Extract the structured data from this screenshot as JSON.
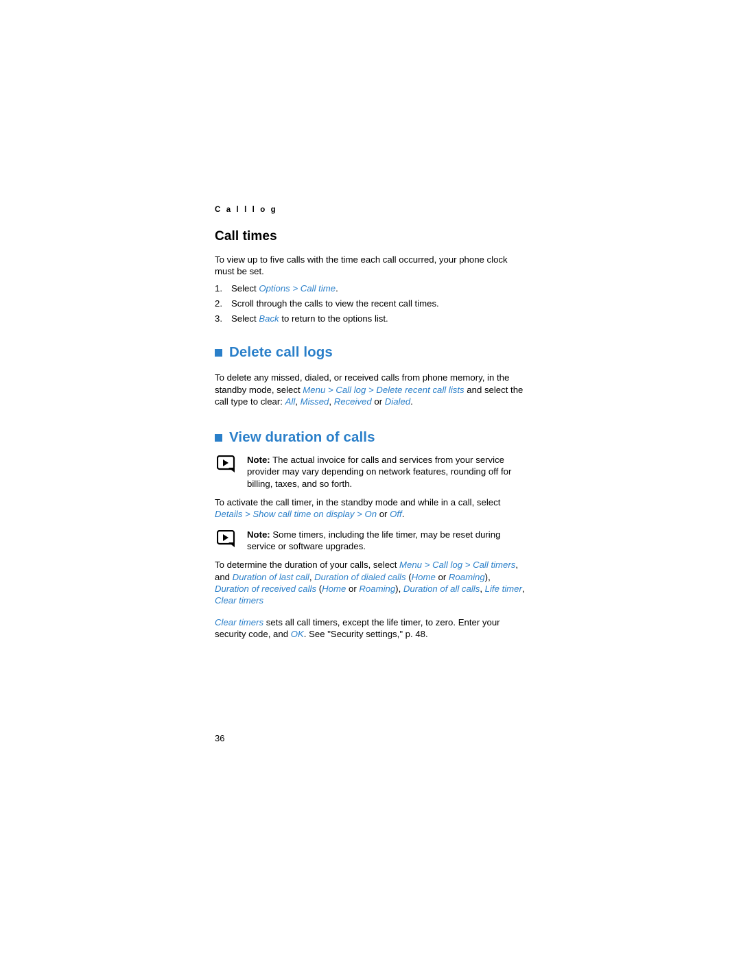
{
  "page": {
    "running_head": "C a l l   l o g",
    "page_number": "36",
    "accent_color": "#2a7fc9"
  },
  "call_times": {
    "heading": "Call times",
    "intro": "To view up to five calls with the time each call occurred, your phone clock must be set.",
    "steps": [
      {
        "num": "1.",
        "pre": "Select ",
        "ui": "Options > Call time",
        "post": "."
      },
      {
        "num": "2.",
        "pre": "Scroll through the calls to view the recent call times.",
        "ui": "",
        "post": ""
      },
      {
        "num": "3.",
        "pre": "Select ",
        "ui": "Back",
        "post": " to return to the options list."
      }
    ]
  },
  "delete_call_logs": {
    "heading": "Delete call logs",
    "para_1a": "To delete any missed, dialed, or received calls from phone memory, in the standby mode, select ",
    "para_1_ui_1": "Menu",
    "para_1b": " > ",
    "para_1_ui_2": "Call log",
    "para_1c": " > ",
    "para_1_ui_3": "Delete recent call lists",
    "para_1d": " and select the call type to clear: ",
    "para_1_ui_4": "All",
    "para_1e": ", ",
    "para_1_ui_5": "Missed",
    "para_1f": ", ",
    "para_1_ui_6": "Received",
    "para_1g": " or ",
    "para_1_ui_7": "Dialed",
    "para_1h": "."
  },
  "view_duration": {
    "heading": "View duration of calls",
    "note_1_label": "Note:",
    "note_1_text": " The actual invoice for calls and services from your service provider may vary depending on network features, rounding off for billing, taxes, and so forth.",
    "para_2a": "To activate the call timer, in the standby mode and while in a call, select ",
    "para_2_ui_1": "Details",
    "para_2b": " > ",
    "para_2_ui_2": "Show call time on display",
    "para_2c": " > ",
    "para_2_ui_3": "On",
    "para_2d": " or ",
    "para_2_ui_4": "Off",
    "para_2e": ".",
    "note_2_label": "Note:",
    "note_2_text": " Some timers, including the life timer, may be reset during service or software upgrades.",
    "para_3a": "To determine the duration of your calls, select ",
    "para_3_ui_1": "Menu",
    "para_3b": " > ",
    "para_3_ui_2": "Call log",
    "para_3c": " > ",
    "para_3_ui_3": "Call timers",
    "para_3d": ", and ",
    "para_3_ui_4": "Duration of last call",
    "para_3e": ", ",
    "para_3_ui_5": "Duration of dialed calls",
    "para_3f": " (",
    "para_3_ui_6": "Home",
    "para_3g": " or ",
    "para_3_ui_7": "Roaming",
    "para_3h": "), ",
    "para_3_ui_8": "Duration of received calls",
    "para_3i": " (",
    "para_3_ui_9": "Home",
    "para_3j": " or ",
    "para_3_ui_10": "Roaming",
    "para_3k": "), ",
    "para_3_ui_11": "Duration of all calls",
    "para_3l": ", ",
    "para_3_ui_12": "Life timer",
    "para_3m": ", ",
    "para_3_ui_13": "Clear timers",
    "para_4_ui_1": "Clear timers",
    "para_4a": " sets all call timers, except the life timer, to zero. Enter your security code, and ",
    "para_4_ui_2": "OK",
    "para_4b": ". See \"Security settings,\" p. 48."
  }
}
